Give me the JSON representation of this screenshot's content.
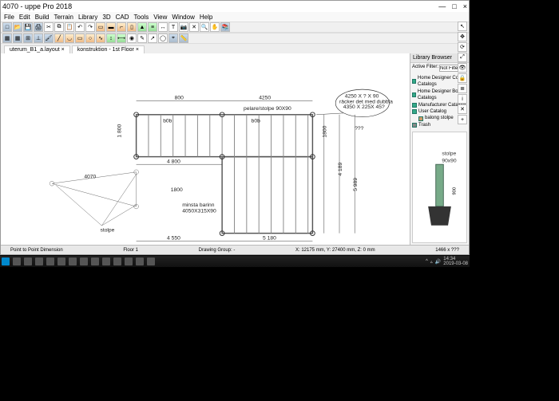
{
  "window": {
    "title": "4070 - uppe Pro 2018",
    "min": "—",
    "max": "□",
    "close": "×"
  },
  "menu": {
    "items": [
      "File",
      "Edit",
      "Build",
      "Terrain",
      "Library",
      "3D",
      "CAD",
      "Tools",
      "View",
      "Window",
      "Help"
    ]
  },
  "tabs": {
    "t1": "uterum_B1_a.layout ×",
    "t2": "konstruktion - 1st Floor ×"
  },
  "drawing": {
    "dim_800": "800",
    "dim_4250": "4250",
    "pillar_label": "pelare/stolpe 90X90",
    "note_bb0_1": "b0b",
    "note_bb0_2": "b0b",
    "dim_4800": "4 800",
    "dim_left_800": "1 800",
    "dim_right_1800": "1800",
    "dim_4550": "4 550",
    "dim_1800": "1800",
    "minsta_barinn": "minsta barinn\n4050X315X90",
    "dim_5180": "5 180",
    "dim_4189": "4 189",
    "dim_5989": "5 989",
    "stolpe": "stolpe",
    "dim_4070": "4070",
    "callout_a": "4250 X ? X 90\nräcker det med dubbla\n4350 X 225 X 45?",
    "callout_arrow": "???"
  },
  "library": {
    "header": "Library Browser",
    "filter_label": "Active Filter:",
    "filter_value": "Not Filtered",
    "nodes": {
      "root": "User Catalog",
      "hd_core": "Home Designer Core Catalogs",
      "hd_bonus": "Home Designer Bonus Catalogs",
      "mfg": "Manufacturer Catalogs",
      "balong": "balong stolpe",
      "trash": "Trash"
    },
    "preview_title": "stolpe",
    "preview_sub": "90x90",
    "preview_h": "900"
  },
  "status": {
    "mode": "Point to Point Dimension",
    "floor": "Floor 1",
    "group": "Drawing Group: -",
    "coords": "X: 12175 mm, Y: 27400 mm, Z: 0 mm",
    "zoom": "1466 x ???"
  },
  "taskbar": {
    "time": "14:34",
    "date": "2019-03-08"
  }
}
